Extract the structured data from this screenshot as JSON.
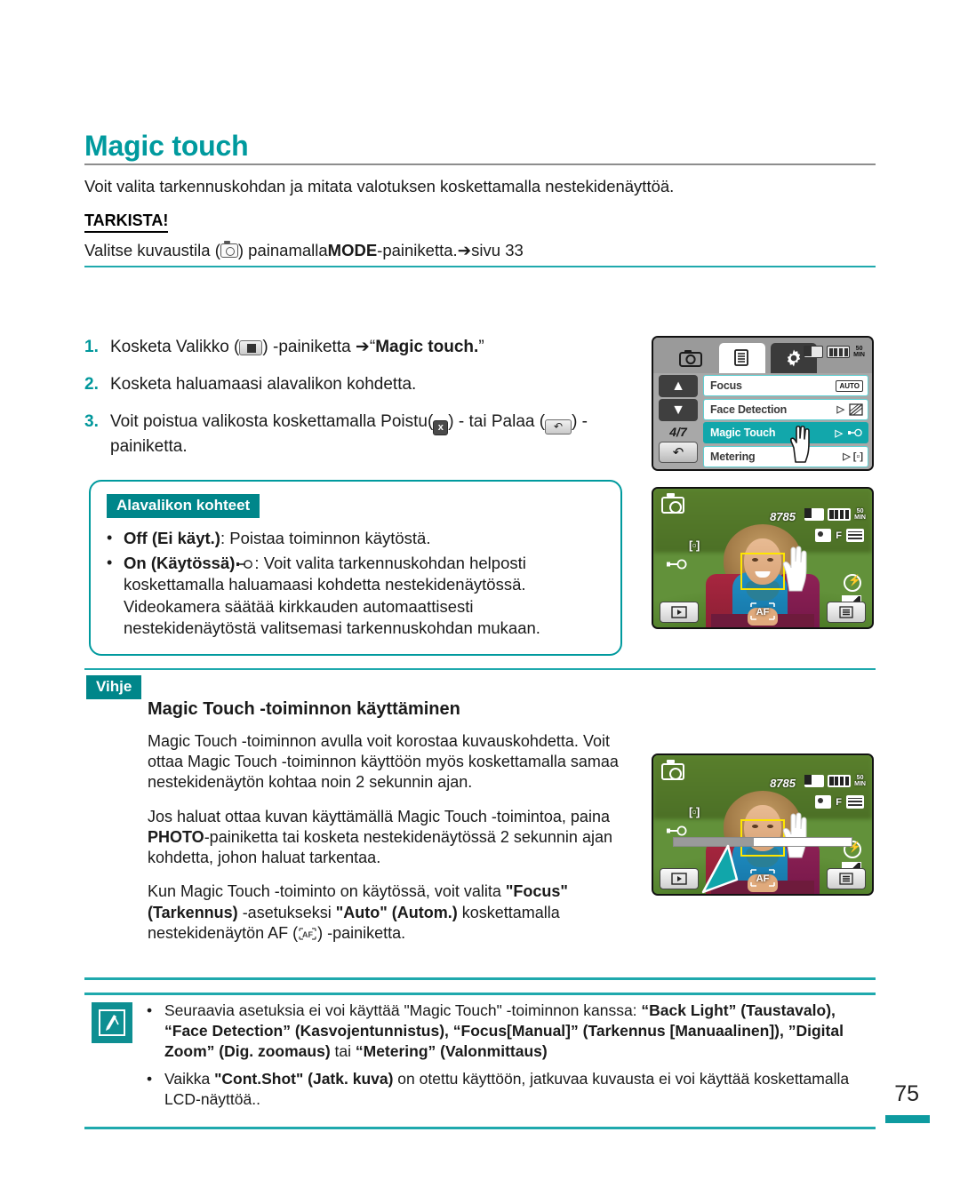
{
  "document": {
    "title": "Magic touch",
    "page_number": "75",
    "intro": "Voit valita tarkennuskohdan ja mitata valotuksen koskettamalla nestekidenäyttöä.",
    "check_label": "TARKISTA!",
    "check_text_before": "Valitse kuvaustila (",
    "check_text_after": ") painamalla ",
    "check_bold": "MODE",
    "check_tail": "-painiketta. ",
    "check_pageref": "➔sivu 33"
  },
  "steps": [
    {
      "num": "1.",
      "text_a": "Kosketa Valikko (",
      "text_b": ") -painiketta ➔“",
      "bold": "Magic touch.",
      "text_c": "”"
    },
    {
      "num": "2.",
      "text_a": "Kosketa haluamaasi alavalikon kohdetta.",
      "text_b": "",
      "bold": "",
      "text_c": ""
    },
    {
      "num": "3.",
      "text_a": "Voit poistua valikosta koskettamalla Poistu(",
      "text_b": ") - tai Palaa (",
      "bold": "",
      "text_c": ") -painiketta."
    }
  ],
  "submenu": {
    "badge": "Alavalikon kohteet",
    "items": [
      {
        "bullet": "•",
        "bold": "Off (Ei käyt.)",
        "rest": ": Poistaa toiminnon käytöstä."
      },
      {
        "bullet": "•",
        "bold": "On (Käytössä)",
        "rest": ": Voit valita tarkennuskohdan helposti koskettamalla haluamaasi kohdetta nestekidenäytössä. Videokamera säätää kirkkauden automaattisesti nestekidenäytöstä valitsemasi tarkennuskohdan mukaan."
      }
    ]
  },
  "tip": {
    "badge": "Vihje",
    "heading": "Magic Touch -toiminnon käyttäminen",
    "para1": "Magic Touch -toiminnon avulla voit korostaa kuvauskohdetta. Voit ottaa Magic Touch -toiminnon käyttöön myös koskettamalla samaa nestekidenäytön kohtaa noin 2 sekunnin ajan.",
    "para2_a": "Jos haluat ottaa kuvan käyttämällä Magic Touch -toimintoa, paina ",
    "para2_bold": "PHOTO",
    "para2_b": "-painiketta tai kosketa nestekidenäytössä 2 sekunnin ajan kohdetta, johon haluat tarkentaa.",
    "para3_a": "Kun Magic Touch -toiminto on käytössä, voit valita ",
    "para3_bold1": "\"Focus\" (Tarkennus)",
    "para3_b": " -asetukseksi ",
    "para3_bold2": "\"Auto\" (Autom.)",
    "para3_c": " koskettamalla nestekidenäytön AF (",
    "para3_d": ") -painiketta."
  },
  "note": {
    "items": [
      {
        "bullet": "•",
        "parts": [
          {
            "text": "Seuraavia asetuksia ei voi käyttää \"Magic Touch\" -toiminnon kanssa: ",
            "bold": false
          },
          {
            "text": "“Back Light” (Taustavalo), “Face Detection” (Kasvojentunnistus), “Focus[Manual]” (Tarkennus [Manuaalinen]), ”Digital Zoom” (Dig. zoomaus)",
            "bold": true
          },
          {
            "text": " tai ",
            "bold": false
          },
          {
            "text": "“Metering” (Valonmittaus)",
            "bold": true
          }
        ]
      },
      {
        "bullet": "•",
        "parts": [
          {
            "text": "Vaikka ",
            "bold": false
          },
          {
            "text": "\"Cont.Shot\" (Jatk. kuva)",
            "bold": true
          },
          {
            "text": " on otettu käyttöön, jatkuvaa kuvausta ei voi käyttää koskettamalla LCD-näyttöä..",
            "bold": false
          }
        ]
      }
    ]
  },
  "lcd_menu": {
    "tabs": [
      {
        "name": "camera-tab",
        "active": false
      },
      {
        "name": "menu-tab",
        "active": true
      },
      {
        "name": "settings-tab",
        "active": false
      }
    ],
    "status": {
      "min_line1": "50",
      "min_line2": "MIN"
    },
    "page_indicator": "4/7",
    "rows": [
      {
        "label": "Focus",
        "right": "AUTO",
        "active": false
      },
      {
        "label": "Face Detection",
        "right": "▷",
        "active": false
      },
      {
        "label": "Magic Touch",
        "right": "▷",
        "active": true
      },
      {
        "label": "Metering",
        "right": "▷ [▫]",
        "active": false
      }
    ]
  },
  "lcd_photo": {
    "counter": "8785",
    "min_line1": "50",
    "min_line2": "MIN",
    "f_label": "F",
    "meter_label": "[▫]",
    "af_label": "AF"
  },
  "colors": {
    "accent_teal": "#009a9e",
    "badge_teal": "#00868a",
    "rule_teal": "#1fa9ad",
    "focus_yellow": "#ffe600",
    "menu_highlight": "#12a7ab"
  }
}
